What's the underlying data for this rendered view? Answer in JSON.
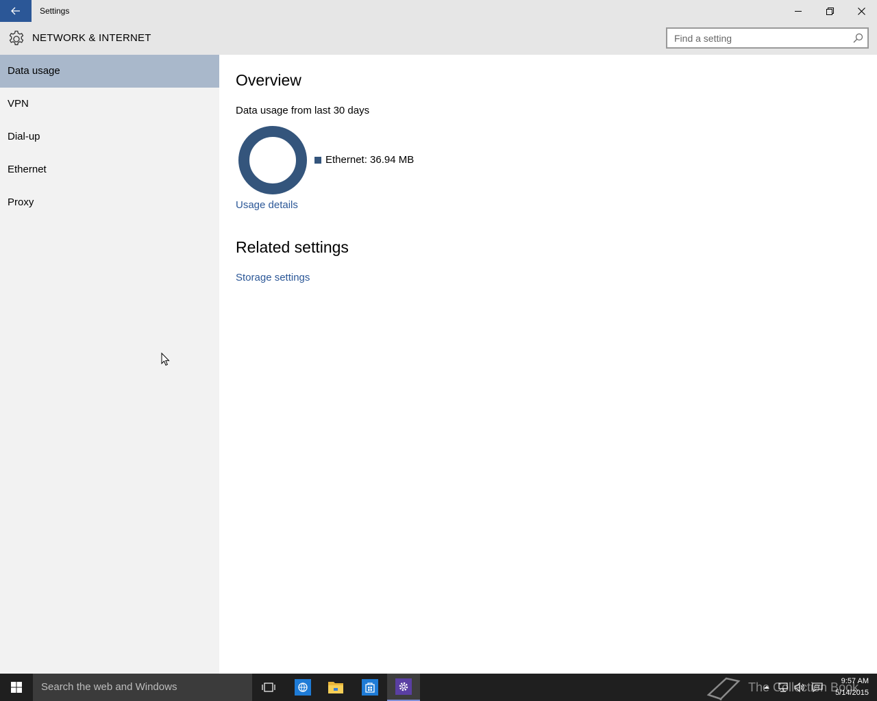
{
  "window": {
    "title": "Settings",
    "controls": {
      "minimize": "minimize-icon",
      "maximize": "restore-icon",
      "close": "close-icon"
    }
  },
  "header": {
    "section_title": "NETWORK & INTERNET",
    "icon": "gear-icon",
    "search_placeholder": "Find a setting"
  },
  "sidebar": {
    "items": [
      {
        "label": "Data usage",
        "active": true
      },
      {
        "label": "VPN",
        "active": false
      },
      {
        "label": "Dial-up",
        "active": false
      },
      {
        "label": "Ethernet",
        "active": false
      },
      {
        "label": "Proxy",
        "active": false
      }
    ]
  },
  "main": {
    "overview_heading": "Overview",
    "usage_subtitle": "Data usage from last 30 days",
    "legend_label": "Ethernet: 36.94 MB",
    "usage_link": "Usage details",
    "related_heading": "Related settings",
    "storage_link": "Storage settings"
  },
  "taskbar": {
    "search_placeholder": "Search the web and Windows",
    "watermark": "The Collection Book",
    "time": "9:57 AM",
    "date": "5/14/2015"
  },
  "colors": {
    "accent": "#2b5797",
    "donut": "#34557c",
    "active_nav": "#a9b8cb",
    "taskbar": "#1f1f1f"
  }
}
